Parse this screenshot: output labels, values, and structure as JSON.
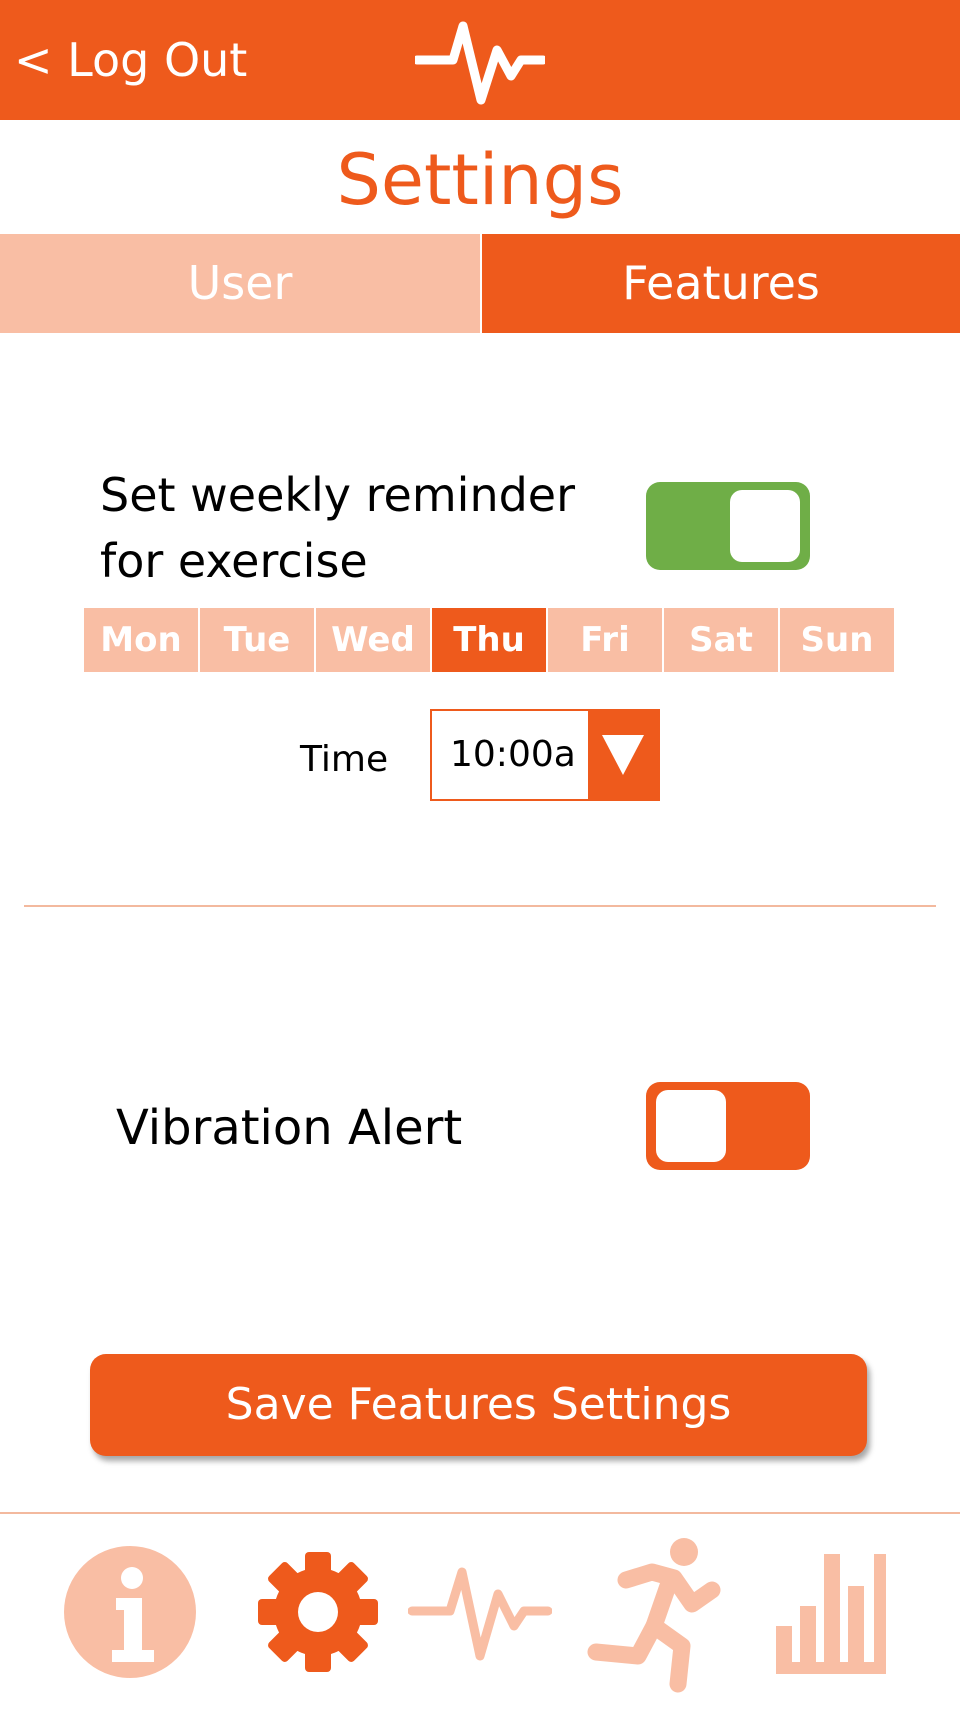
{
  "header": {
    "logout_label": "< Log Out",
    "logo_icon": "heartbeat-icon"
  },
  "page_title": "Settings",
  "tabs": [
    {
      "label": "User",
      "active": false
    },
    {
      "label": "Features",
      "active": true
    }
  ],
  "reminder": {
    "label": "Set weekly reminder\nfor exercise",
    "enabled": true,
    "days": [
      {
        "label": "Mon",
        "selected": false
      },
      {
        "label": "Tue",
        "selected": false
      },
      {
        "label": "Wed",
        "selected": false
      },
      {
        "label": "Thu",
        "selected": true
      },
      {
        "label": "Fri",
        "selected": false
      },
      {
        "label": "Sat",
        "selected": false
      },
      {
        "label": "Sun",
        "selected": false
      }
    ],
    "time_label": "Time",
    "time_value": "10:00a"
  },
  "vibration": {
    "label": "Vibration Alert",
    "enabled": false
  },
  "save_button": {
    "label": "Save Features Settings"
  },
  "bottom_nav": [
    {
      "icon": "info-icon",
      "active": false
    },
    {
      "icon": "gear-icon",
      "active": true
    },
    {
      "icon": "heartbeat-icon",
      "active": false
    },
    {
      "icon": "running-person-icon",
      "active": false
    },
    {
      "icon": "bar-chart-icon",
      "active": false
    }
  ],
  "colors": {
    "accent": "#ee5a1c",
    "accent_light": "#f9bea4",
    "toggle_on": "#6fae47",
    "white": "#ffffff",
    "text": "#000000"
  }
}
